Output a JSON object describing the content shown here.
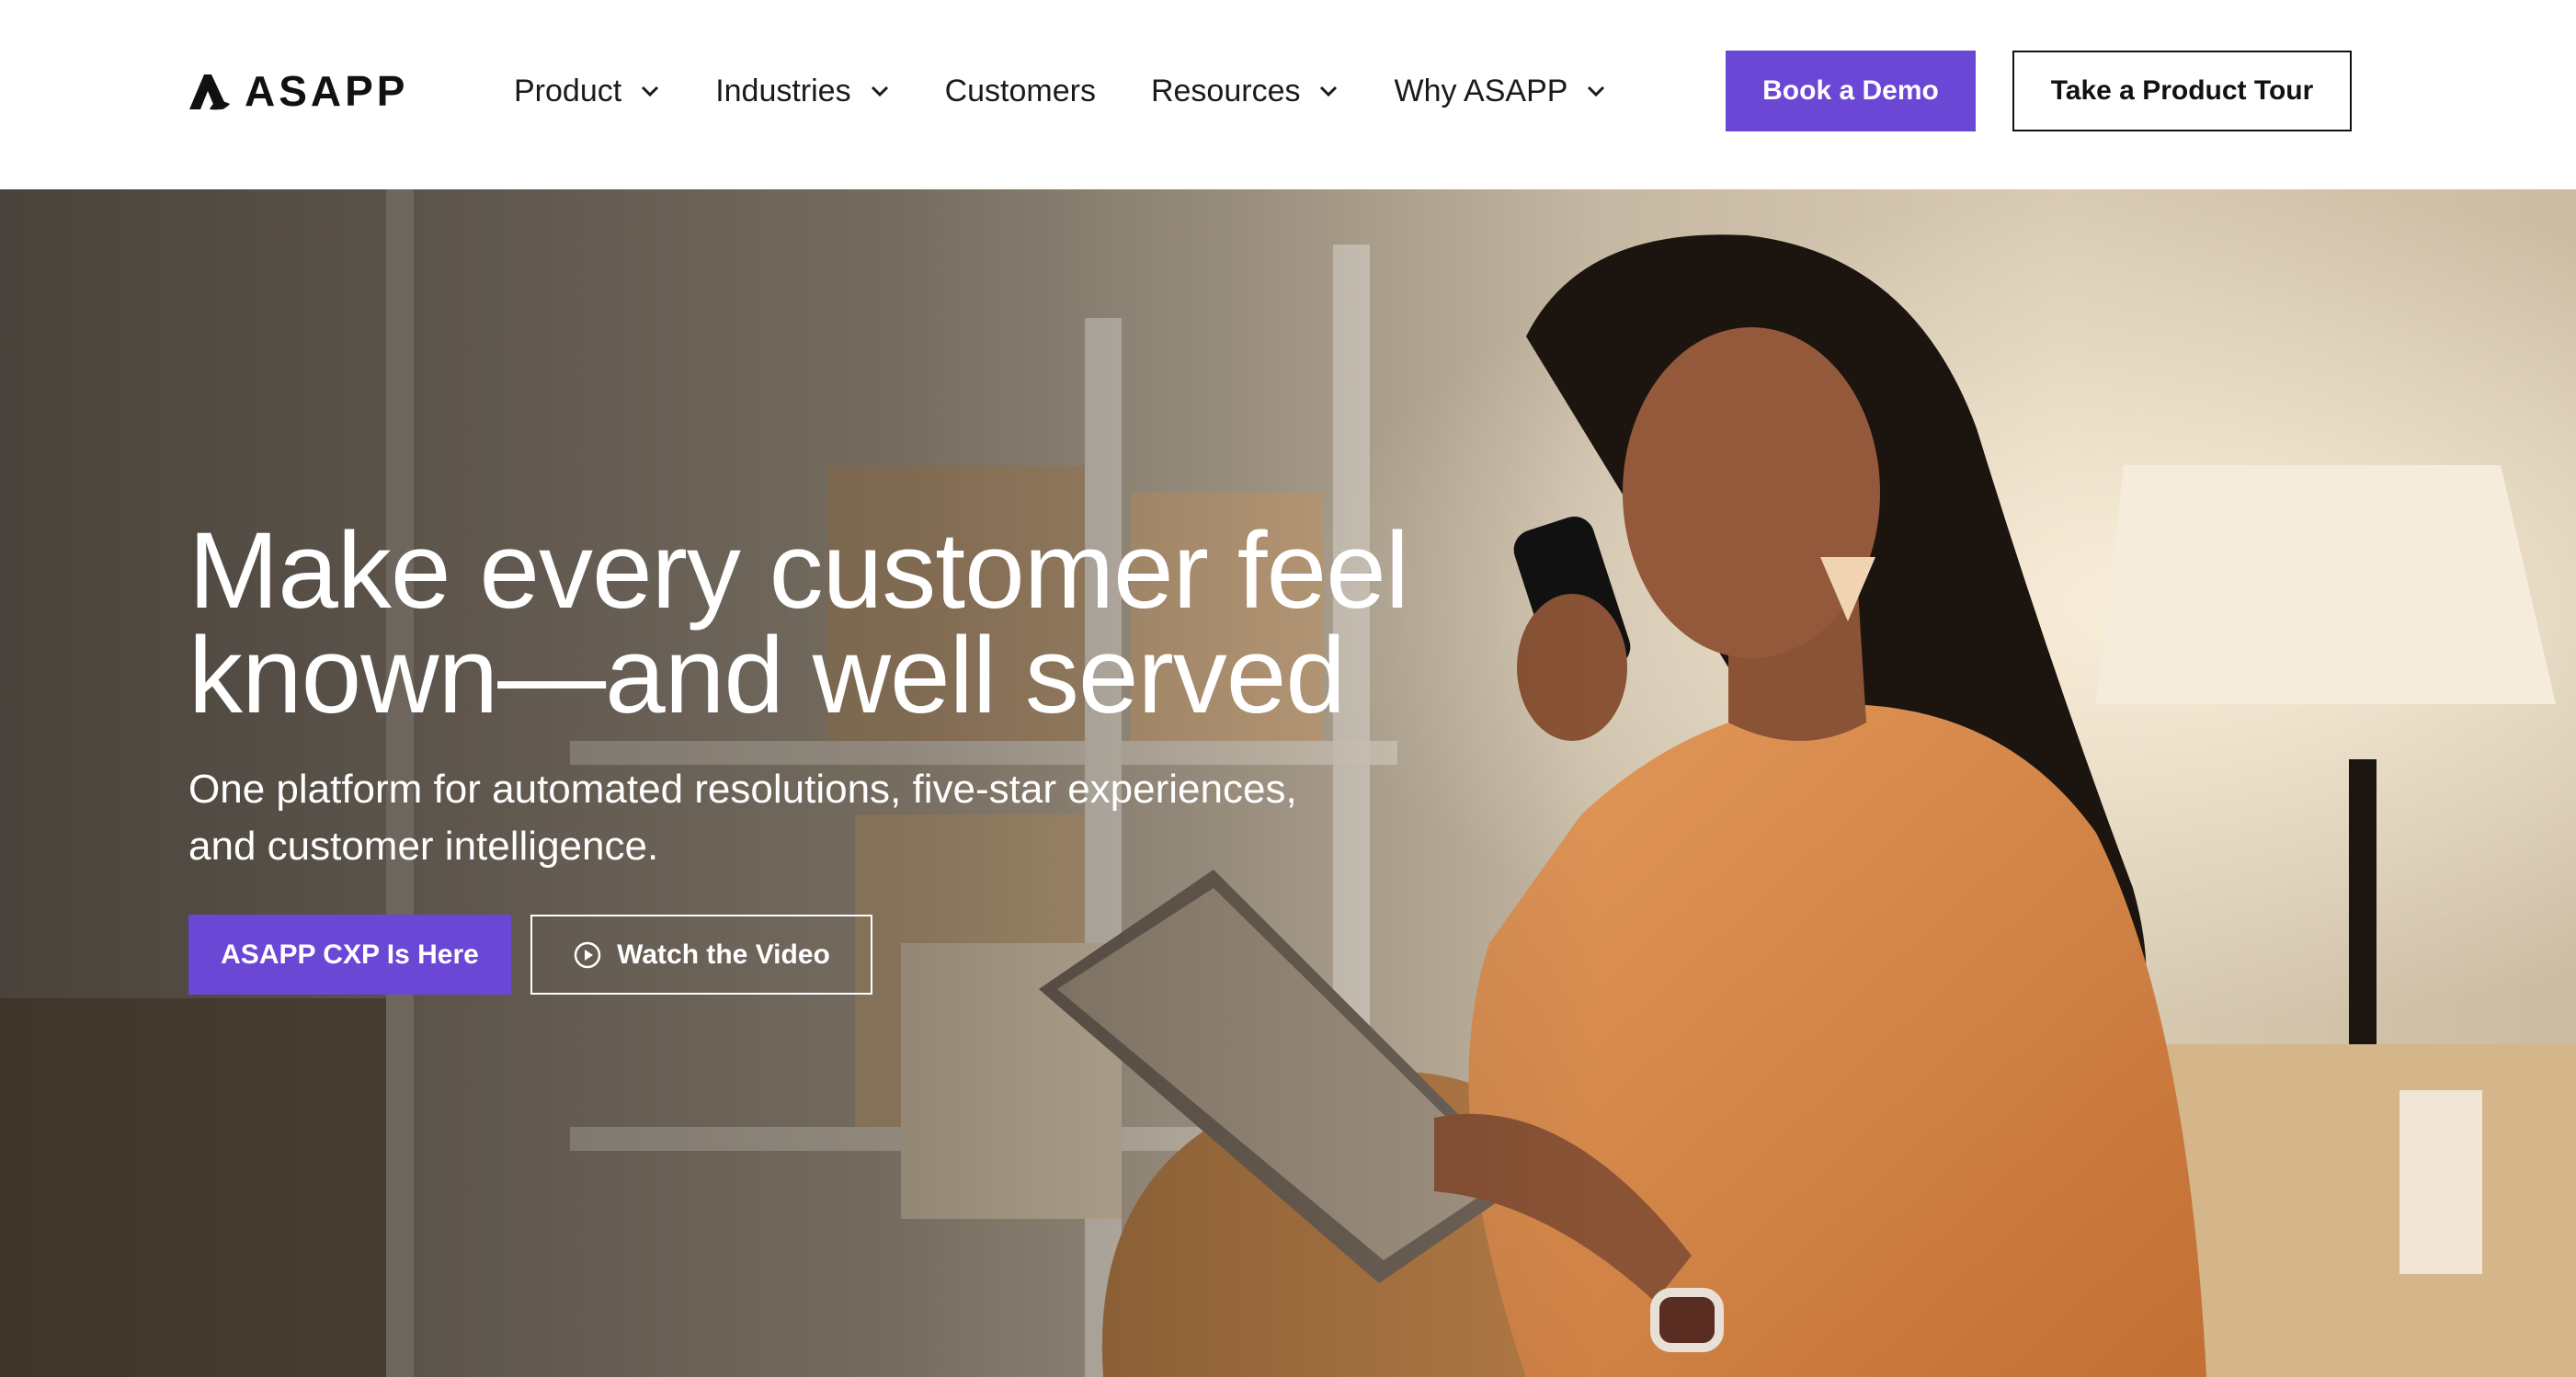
{
  "brand": {
    "name": "ASAPP",
    "logo_icon": "asapp-logo-mark"
  },
  "nav": {
    "items": [
      {
        "label": "Product",
        "has_dropdown": true
      },
      {
        "label": "Industries",
        "has_dropdown": true
      },
      {
        "label": "Customers",
        "has_dropdown": false
      },
      {
        "label": "Resources",
        "has_dropdown": true
      },
      {
        "label": "Why ASAPP",
        "has_dropdown": true
      }
    ]
  },
  "header": {
    "demo_label": "Book a Demo",
    "tour_label": "Take a Product Tour"
  },
  "hero": {
    "title_line1": "Make every customer feel",
    "title_line2": "known—and well served",
    "subtitle_line1": "One platform for automated resolutions, five-star experiences,",
    "subtitle_line2": "and customer intelligence.",
    "primary_cta": "ASAPP CXP Is Here",
    "secondary_cta": "Watch the Video",
    "secondary_icon": "play-circle-icon"
  },
  "colors": {
    "accent": "#6b47d6",
    "header_bg": "#ffffff",
    "text_dark": "#111111",
    "hero_text": "#ffffff",
    "shirt_orange": "#d9894a"
  }
}
